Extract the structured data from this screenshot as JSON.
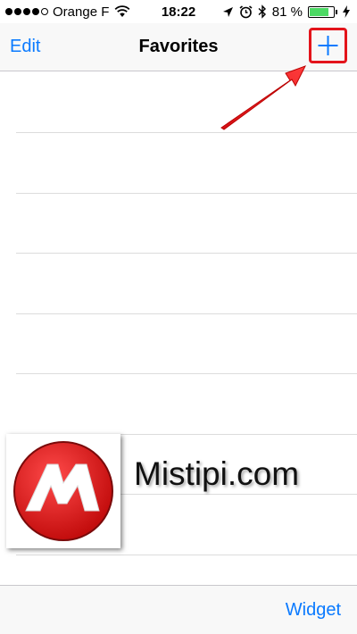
{
  "status_bar": {
    "carrier": "Orange F",
    "time": "18:22",
    "battery_percent_label": "81 %",
    "battery_level": 0.81,
    "icons": [
      "signal-dots-icon",
      "wifi-icon",
      "location-icon",
      "alarm-icon",
      "bluetooth-icon",
      "battery-icon",
      "charging-icon"
    ]
  },
  "nav": {
    "edit_label": "Edit",
    "title": "Favorites",
    "add_icon": "plus-icon"
  },
  "list": {
    "rows": [
      "",
      "",
      "",
      "",
      "",
      "",
      "",
      ""
    ]
  },
  "watermark": {
    "logo_letter": "M",
    "text": "Mistipi.com"
  },
  "toolbar": {
    "widget_label": "Widget"
  },
  "annotation": {
    "highlight_color": "#e3141b",
    "arrow_icon": "red-arrow-icon"
  },
  "colors": {
    "accent": "#0a7aff",
    "battery_green": "#4cd964",
    "separator": "#dcdcdc"
  }
}
